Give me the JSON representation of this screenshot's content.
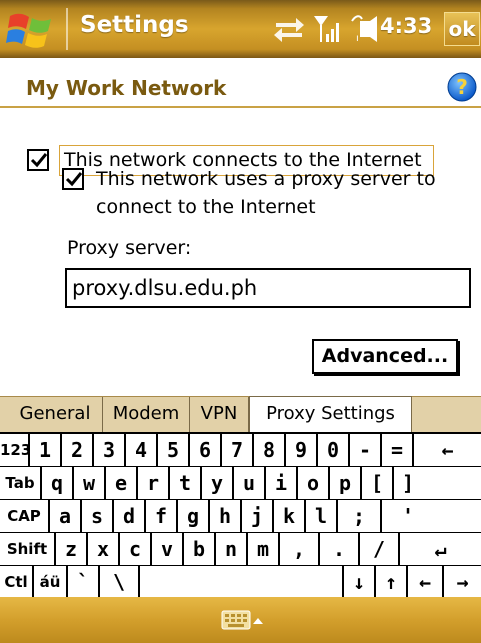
{
  "titlebar": {
    "title": "Settings",
    "time": "4:33",
    "ok_label": "ok",
    "icons": [
      "windows-start-icon",
      "connectivity-icon",
      "signal-icon",
      "volume-icon"
    ],
    "colors": {
      "bar": "#c48f22",
      "title_text": "#ffffff"
    }
  },
  "header": {
    "title": "My Work Network",
    "help_icon": "help-icon",
    "color": "#7a5a10"
  },
  "options": {
    "internet": {
      "label": "This network connects to the Internet",
      "checked": true
    },
    "proxy": {
      "label_line1": "This network uses a proxy server to",
      "label_line2": "connect to the Internet",
      "checked": true
    }
  },
  "proxy_server": {
    "label": "Proxy server:",
    "value": "proxy.dlsu.edu.ph"
  },
  "advanced_label": "Advanced...",
  "tabs": [
    {
      "label": "General",
      "active": false
    },
    {
      "label": "Modem",
      "active": false
    },
    {
      "label": "VPN",
      "active": false
    },
    {
      "label": "Proxy Settings",
      "active": true
    }
  ],
  "keyboard": {
    "row1": [
      "123",
      "1",
      "2",
      "3",
      "4",
      "5",
      "6",
      "7",
      "8",
      "9",
      "0",
      "-",
      "=",
      "←"
    ],
    "row2": [
      "Tab",
      "q",
      "w",
      "e",
      "r",
      "t",
      "y",
      "u",
      "i",
      "o",
      "p",
      "[",
      "]"
    ],
    "row3": [
      "CAP",
      "a",
      "s",
      "d",
      "f",
      "g",
      "h",
      "j",
      "k",
      "l",
      ";",
      "'"
    ],
    "row4": [
      "Shift",
      "z",
      "x",
      "c",
      "v",
      "b",
      "n",
      "m",
      ",",
      ".",
      "/",
      "↵"
    ],
    "row5": [
      "Ctl",
      "áü",
      "`",
      "\\",
      "",
      "↓",
      "↑",
      "←",
      "→"
    ]
  },
  "bottombar": {
    "icons": [
      "keyboard-icon",
      "input-menu-arrow-icon"
    ]
  }
}
